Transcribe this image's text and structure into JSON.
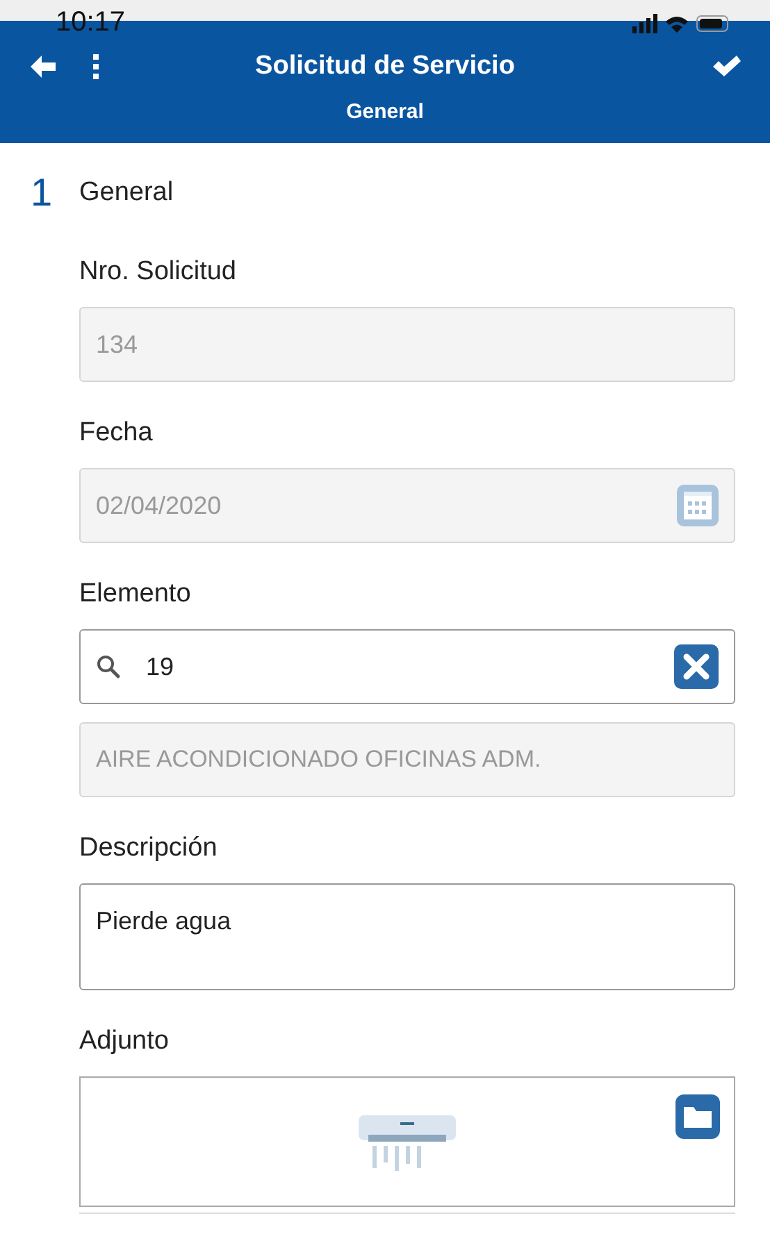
{
  "status_bar": {
    "time": "10:17"
  },
  "header": {
    "title": "Solicitud de Servicio",
    "subtitle": "General"
  },
  "section": {
    "number": "1",
    "title": "General"
  },
  "fields": [
    {
      "kind": "text",
      "label": "Nro. Solicitud",
      "value": "134",
      "disabled": true
    },
    {
      "kind": "date",
      "label": "Fecha",
      "value": "02/04/2020",
      "disabled": true
    },
    {
      "kind": "lookup",
      "label": "Elemento",
      "value": "19",
      "description": "AIRE ACONDICIONADO OFICINAS ADM.",
      "disabled": false
    },
    {
      "kind": "textarea",
      "label": "Descripción",
      "value": "Pierde agua",
      "disabled": false
    },
    {
      "kind": "attachment",
      "label": "Adjunto"
    }
  ]
}
